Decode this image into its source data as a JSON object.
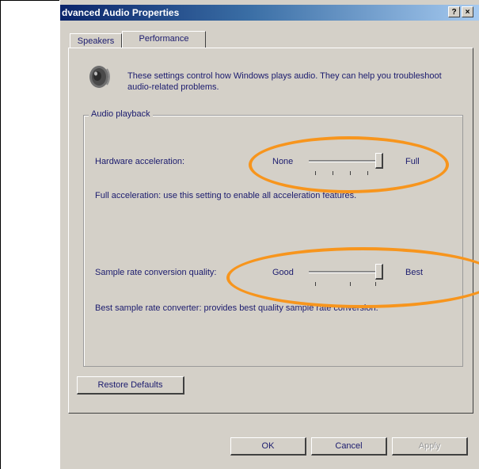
{
  "window": {
    "title": "dvanced Audio Properties",
    "help_label": "?",
    "close_label": "×"
  },
  "tabs": [
    {
      "label": "Speakers",
      "selected": false
    },
    {
      "label": "Performance",
      "selected": true
    }
  ],
  "intro_text": "These settings control how Windows plays audio. They can help you troubleshoot audio-related problems.",
  "group": {
    "label": "Audio playback",
    "hardware": {
      "label": "Hardware acceleration:",
      "min_label": "None",
      "max_label": "Full",
      "level": 1.0,
      "description": "Full acceleration: use this setting to enable all acceleration features."
    },
    "sample_rate": {
      "label": "Sample rate conversion quality:",
      "min_label": "Good",
      "max_label": "Best",
      "level": 1.0,
      "description": "Best sample rate converter: provides best quality sample rate conversion."
    }
  },
  "buttons": {
    "restore_defaults": "Restore Defaults",
    "ok": "OK",
    "cancel": "Cancel",
    "apply": "Apply"
  },
  "colors": {
    "highlight": "#f7951d",
    "dialog_face": "#d4d0c8",
    "text": "#1b1b6e"
  },
  "icons": {
    "dialog": "speaker-icon"
  }
}
